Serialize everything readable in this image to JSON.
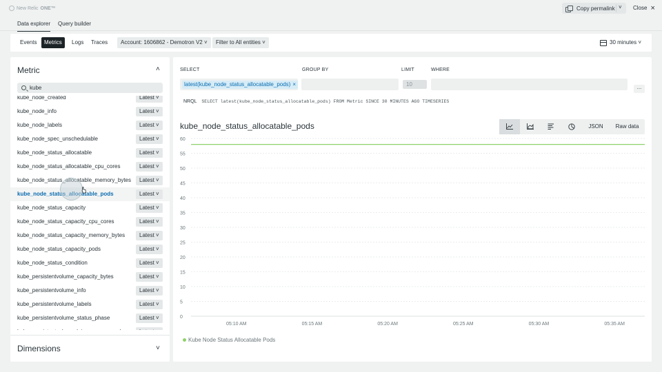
{
  "app": {
    "brand_prefix": "New Relic",
    "brand_bold": "ONE™"
  },
  "header": {
    "permalink_label": "Copy permalink",
    "close_label": "Close"
  },
  "subtabs": [
    {
      "label": "Data explorer",
      "active": true
    },
    {
      "label": "Query builder",
      "active": false
    }
  ],
  "filterbar": {
    "tabs": [
      {
        "label": "Events",
        "active": false
      },
      {
        "label": "Metrics",
        "active": true
      },
      {
        "label": "Logs",
        "active": false
      },
      {
        "label": "Traces",
        "active": false
      }
    ],
    "account": "Account: 1606862 - Demotron V2 ˅",
    "entities": "Filter to All entities ˅",
    "time": "30 minutes ˅"
  },
  "metric_panel": {
    "title": "Metric",
    "search_value": "kube",
    "items": [
      {
        "name": "kube_node_created",
        "agg": "Latest ˅"
      },
      {
        "name": "kube_node_info",
        "agg": "Latest ˅"
      },
      {
        "name": "kube_node_labels",
        "agg": "Latest ˅"
      },
      {
        "name": "kube_node_spec_unschedulable",
        "agg": "Latest ˅"
      },
      {
        "name": "kube_node_status_allocatable",
        "agg": "Latest ˅"
      },
      {
        "name": "kube_node_status_allocatable_cpu_cores",
        "agg": "Latest ˅"
      },
      {
        "name": "kube_node_status_allocatable_memory_bytes",
        "agg": "Latest ˅"
      },
      {
        "name": "kube_node_status_allocatable_pods",
        "agg": "Latest ˅",
        "selected": true
      },
      {
        "name": "kube_node_status_capacity",
        "agg": "Latest ˅"
      },
      {
        "name": "kube_node_status_capacity_cpu_cores",
        "agg": "Latest ˅"
      },
      {
        "name": "kube_node_status_capacity_memory_bytes",
        "agg": "Latest ˅"
      },
      {
        "name": "kube_node_status_capacity_pods",
        "agg": "Latest ˅"
      },
      {
        "name": "kube_node_status_condition",
        "agg": "Latest ˅"
      },
      {
        "name": "kube_persistentvolume_capacity_bytes",
        "agg": "Latest ˅"
      },
      {
        "name": "kube_persistentvolume_info",
        "agg": "Latest ˅"
      },
      {
        "name": "kube_persistentvolume_labels",
        "agg": "Latest ˅"
      },
      {
        "name": "kube_persistentvolume_status_phase",
        "agg": "Latest ˅"
      },
      {
        "name": "kube_persistentvolumeclaim_access_mode",
        "agg": "Latest ˅"
      }
    ],
    "dimensions_title": "Dimensions"
  },
  "query": {
    "select_label": "SELECT",
    "group_by_label": "GROUP BY",
    "limit_label": "LIMIT",
    "where_label": "WHERE",
    "select_chip": "latest(kube_node_status_allocatable_pods)",
    "limit_value": "10",
    "more": "...",
    "nrql_keyword": "NRQL",
    "nrql_text": "SELECT latest(kube_node_status_allocatable_pods) FROM Metric SINCE 30 MINUTES AGO TIMESERIES"
  },
  "chart_toolbar": {
    "json_label": "JSON",
    "raw_label": "Raw data"
  },
  "chart_data": {
    "type": "line",
    "title": "kube_node_status_allocatable_pods",
    "xlabel": "",
    "ylabel": "",
    "ylim": [
      0,
      60
    ],
    "yticks": [
      0,
      5,
      10,
      15,
      20,
      25,
      30,
      35,
      40,
      45,
      50,
      55,
      60
    ],
    "xticks": [
      "05:10 AM",
      "05:15 AM",
      "05:20 AM",
      "05:25 AM",
      "05:30 AM",
      "05:35 AM"
    ],
    "grid": true,
    "legend": "bottom-left",
    "series": [
      {
        "name": "Kube Node Status Allocatable Pods",
        "color": "#8ed26b",
        "x": [
          "05:07 AM",
          "05:37 AM"
        ],
        "values": [
          58,
          58
        ]
      }
    ]
  }
}
